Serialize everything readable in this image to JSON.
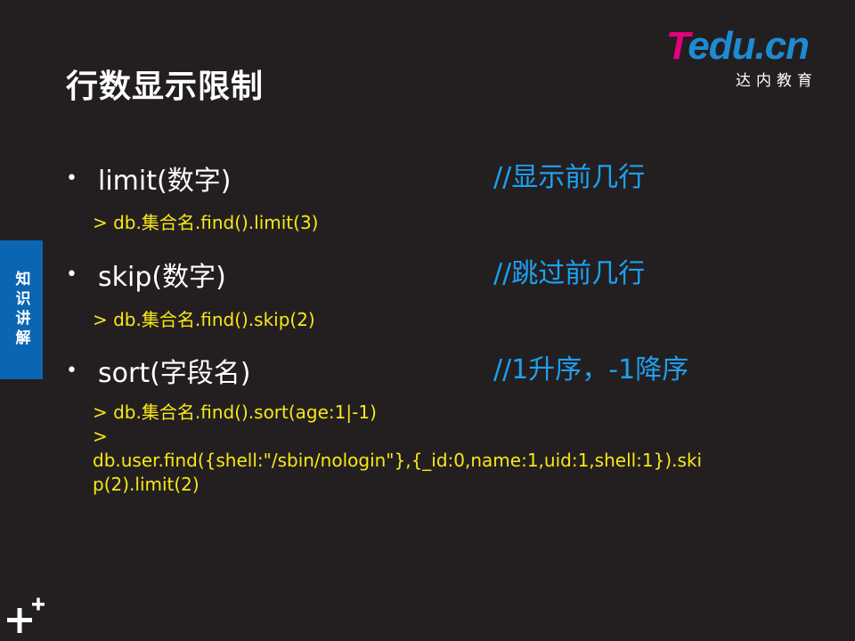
{
  "slide": {
    "title": "行数显示限制",
    "logo": {
      "brand_t": "T",
      "brand_rest": "edu.cn",
      "subtitle": "达内教育"
    },
    "side_tab": "知识讲解",
    "bullets": [
      {
        "label": "limit(数字)",
        "comment": "//显示前几行",
        "code": "> db.集合名.find().limit(3)"
      },
      {
        "label": "skip(数字)",
        "comment": "//跳过前几行",
        "code": "> db.集合名.find().skip(2)"
      },
      {
        "label": "sort(字段名)",
        "comment": "//1升序，-1降序",
        "code_lines": [
          "> db.集合名.find().sort(age:1|-1)",
          ">",
          "db.user.find({shell:\"/sbin/nologin\"},{_id:0,name:1,uid:1,shell:1}).ski",
          "p(2).limit(2)"
        ]
      }
    ]
  },
  "colors": {
    "background": "#231f20",
    "comment": "#1da1f2",
    "code": "#f7e818",
    "side_tab": "#0a66b3",
    "logo_t": "#e6007e",
    "logo_rest": "#1d8bd3"
  },
  "icons": {
    "corner": "plus-decoration-icon"
  }
}
